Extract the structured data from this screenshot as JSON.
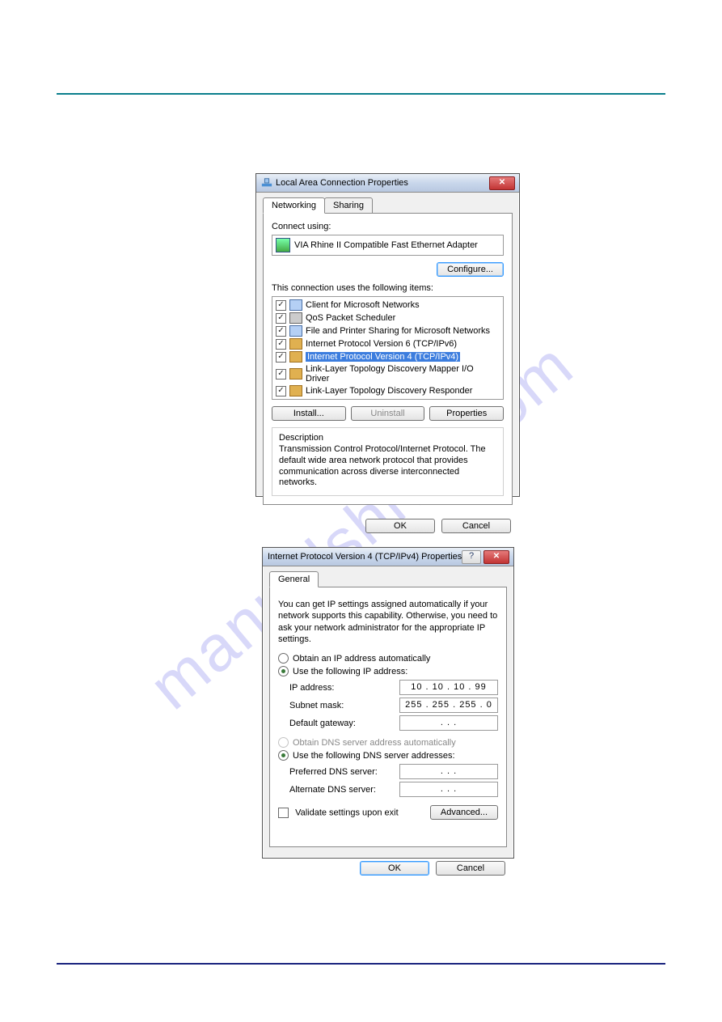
{
  "watermark": "manualshive.com",
  "dlg1": {
    "title": "Local Area Connection Properties",
    "tab1": "Networking",
    "tab2": "Sharing",
    "connect_using_label": "Connect using:",
    "adapter_name": "VIA Rhine II Compatible Fast Ethernet Adapter",
    "configure_btn": "Configure...",
    "items_label": "This connection uses the following items:",
    "items": [
      {
        "label": "Client for Microsoft Networks",
        "checked": true,
        "icon": "net"
      },
      {
        "label": "QoS Packet Scheduler",
        "checked": true,
        "icon": "pkt"
      },
      {
        "label": "File and Printer Sharing for Microsoft Networks",
        "checked": true,
        "icon": "net"
      },
      {
        "label": "Internet Protocol Version 6 (TCP/IPv6)",
        "checked": true,
        "icon": "proto"
      },
      {
        "label": "Internet Protocol Version 4 (TCP/IPv4)",
        "checked": true,
        "icon": "proto",
        "selected": true
      },
      {
        "label": "Link-Layer Topology Discovery Mapper I/O Driver",
        "checked": true,
        "icon": "proto"
      },
      {
        "label": "Link-Layer Topology Discovery Responder",
        "checked": true,
        "icon": "proto"
      }
    ],
    "install_btn": "Install...",
    "uninstall_btn": "Uninstall",
    "properties_btn": "Properties",
    "description_legend": "Description",
    "description_text": "Transmission Control Protocol/Internet Protocol. The default wide area network protocol that provides communication across diverse interconnected networks.",
    "ok_btn": "OK",
    "cancel_btn": "Cancel"
  },
  "dlg2": {
    "title": "Internet Protocol Version 4 (TCP/IPv4) Properties",
    "tab_general": "General",
    "info": "You can get IP settings assigned automatically if your network supports this capability. Otherwise, you need to ask your network administrator for the appropriate IP settings.",
    "radio_auto_ip": "Obtain an IP address automatically",
    "radio_manual_ip": "Use the following IP address:",
    "label_ip": "IP address:",
    "label_mask": "Subnet mask:",
    "label_gw": "Default gateway:",
    "val_ip": "10 . 10 . 10 . 99",
    "val_mask": "255 . 255 . 255 . 0",
    "val_gw": ".       .       .",
    "radio_auto_dns": "Obtain DNS server address automatically",
    "radio_manual_dns": "Use the following DNS server addresses:",
    "label_pdns": "Preferred DNS server:",
    "label_adns": "Alternate DNS server:",
    "val_pdns": ".       .       .",
    "val_adns": ".       .       .",
    "validate_label": "Validate settings upon exit",
    "advanced_btn": "Advanced...",
    "ok_btn": "OK",
    "cancel_btn": "Cancel"
  }
}
